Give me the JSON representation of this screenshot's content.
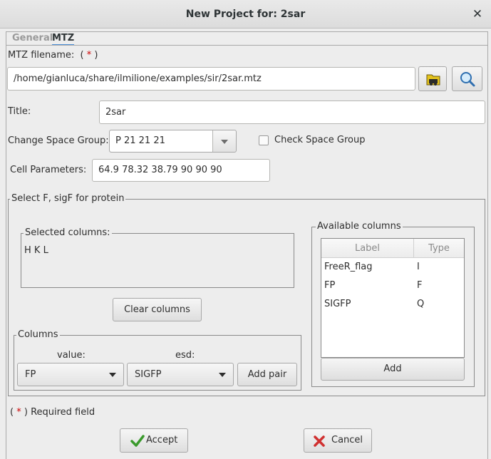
{
  "window": {
    "title": "New Project for: 2sar"
  },
  "tabs": [
    {
      "label": "General"
    },
    {
      "label": "MTZ"
    }
  ],
  "mtz": {
    "filename_label": "MTZ filename:",
    "required_open": "(",
    "required_mark": "*",
    "required_close": ")",
    "filename_value": "/home/gianluca/share/ilmilione/examples/sir/2sar.mtz"
  },
  "title_field": {
    "label": "Title:",
    "value": "2sar"
  },
  "space_group": {
    "label": "Change Space Group:",
    "value": "P 21 21 21",
    "check_label": "Check Space Group"
  },
  "cell": {
    "label": "Cell Parameters:",
    "value": "64.9 78.32 38.79 90 90 90"
  },
  "select_group": {
    "title": "Select F, sigF for protein"
  },
  "selected": {
    "title": "Selected columns:",
    "value": "H K L"
  },
  "clear_button": "Clear columns",
  "columns_group": {
    "title": "Columns",
    "value_label": "value:",
    "esd_label": "esd:",
    "value_selected": "FP",
    "esd_selected": "SIGFP",
    "add_pair": "Add pair"
  },
  "available": {
    "title": "Available columns",
    "headers": {
      "label": "Label",
      "type": "Type"
    },
    "rows": [
      {
        "label": "FreeR_flag",
        "type": "I"
      },
      {
        "label": "FP",
        "type": "F"
      },
      {
        "label": "SIGFP",
        "type": "Q"
      }
    ],
    "add_button": "Add"
  },
  "footer": {
    "required_open": "(",
    "required_mark": "*",
    "required_close": ") Required field",
    "accept": "Accept",
    "cancel": "Cancel"
  },
  "icons": {
    "close": "close-icon",
    "folder": "folder-icon",
    "search": "magnifier-icon",
    "accept": "checkmark-icon",
    "cancel": "cross-icon",
    "dropdown": "chevron-down-icon"
  },
  "colors": {
    "required": "#cc0000",
    "tab_underline": "#4a90d9",
    "accept_icon": "#3a9a2c",
    "cancel_icon": "#d03030"
  }
}
